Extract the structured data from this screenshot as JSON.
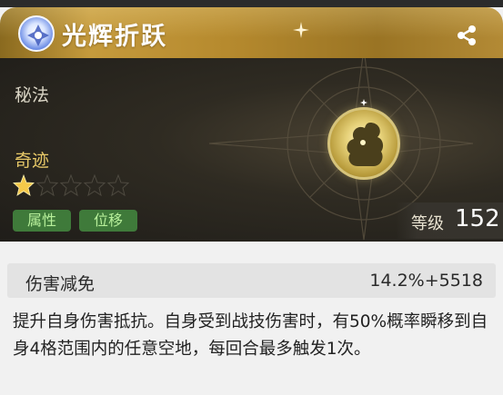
{
  "header": {
    "title": "光辉折跃",
    "title_icon": "element-crystal-icon",
    "share_icon": "share-icon"
  },
  "card": {
    "type_label": "秘法",
    "rarity_label": "奇迹",
    "stars": {
      "filled": 1,
      "total": 5
    },
    "tags": [
      "属性",
      "位移"
    ],
    "level_label": "等级",
    "level_value": "152",
    "emblem_icon": "creature-emblem-icon"
  },
  "stat": {
    "name": "伤害减免",
    "value": "14.2%+5518"
  },
  "description": "提升自身伤害抵抗。自身受到战技伤害时，有50%概率瞬移到自身4格范围内的任意空地，每回合最多触发1次。",
  "colors": {
    "header_gold": "#c59a3c",
    "panel_dark": "#2f2b22",
    "rarity_gold": "#e8c968",
    "tag_green": "#3f7a3a",
    "tag_text": "#b7ef9a"
  }
}
